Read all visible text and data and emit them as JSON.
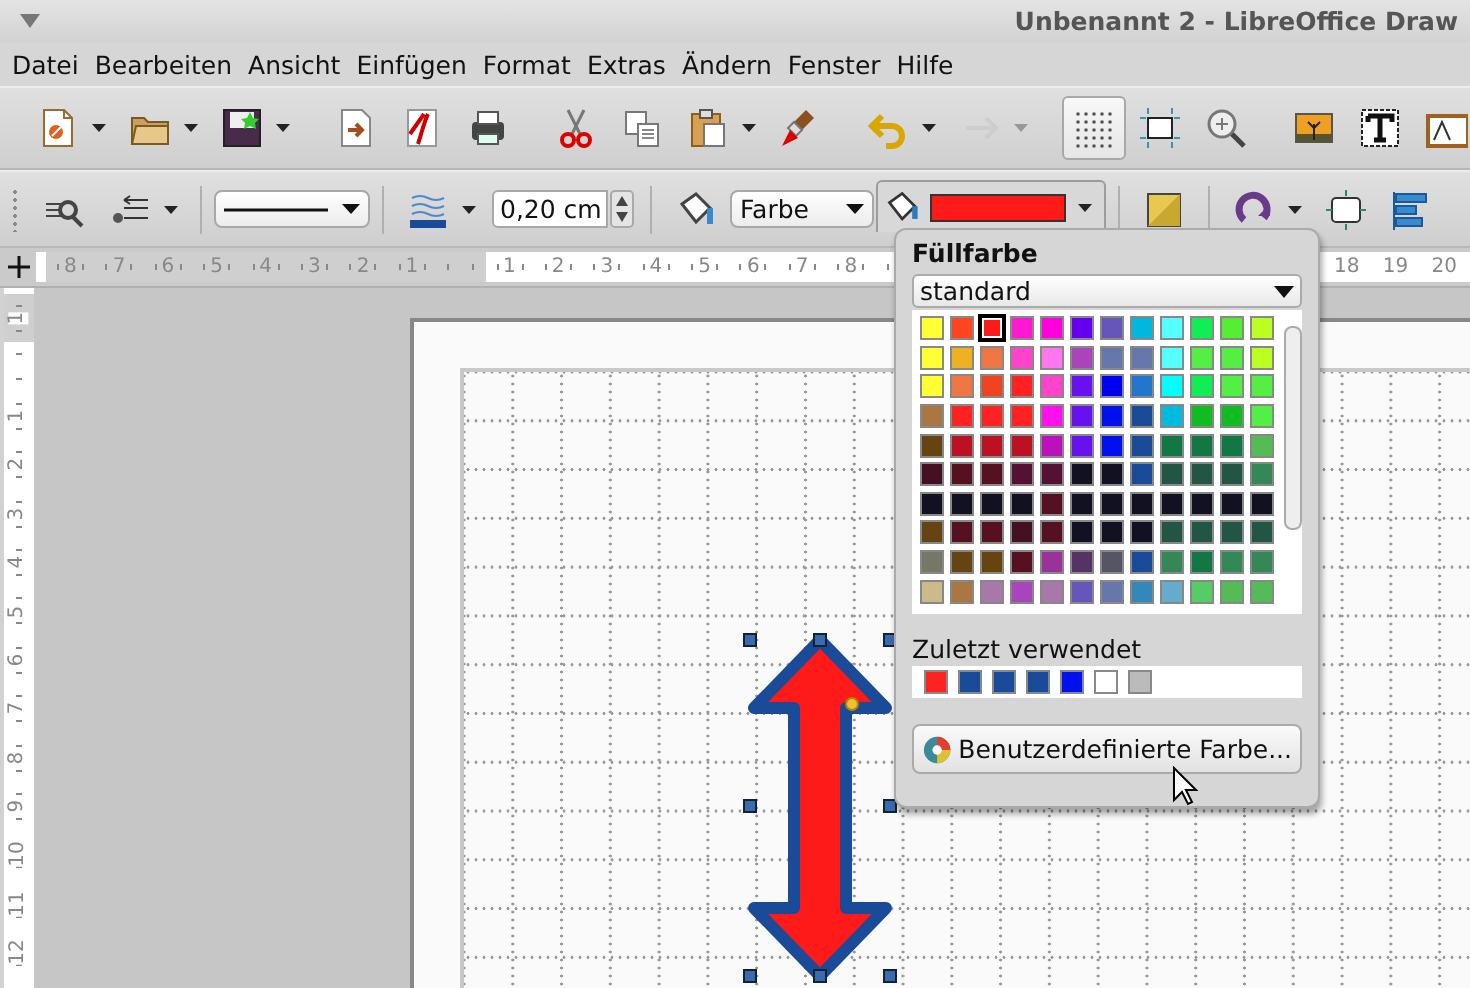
{
  "window": {
    "title": "Unbenannt 2 - LibreOffice Draw"
  },
  "menu": [
    "Datei",
    "Bearbeiten",
    "Ansicht",
    "Einfügen",
    "Format",
    "Extras",
    "Ändern",
    "Fenster",
    "Hilfe"
  ],
  "standard_toolbar": [
    {
      "kind": "button",
      "dropdown": true,
      "disabled": false,
      "pressed": false
    },
    {
      "kind": "button",
      "dropdown": true,
      "disabled": false,
      "pressed": false
    },
    {
      "kind": "button",
      "dropdown": true,
      "disabled": false,
      "pressed": false
    },
    {
      "kind": "separator"
    },
    {
      "kind": "button",
      "dropdown": false,
      "disabled": false,
      "pressed": false
    },
    {
      "kind": "button",
      "dropdown": false,
      "disabled": false,
      "pressed": false
    },
    {
      "kind": "button",
      "dropdown": false,
      "disabled": false,
      "pressed": false
    },
    {
      "kind": "separator"
    },
    {
      "kind": "button",
      "dropdown": false,
      "disabled": false,
      "pressed": false
    },
    {
      "kind": "button",
      "dropdown": false,
      "disabled": false,
      "pressed": false
    },
    {
      "kind": "button",
      "dropdown": true,
      "disabled": false,
      "pressed": false
    },
    {
      "kind": "button",
      "dropdown": false,
      "disabled": false,
      "pressed": false
    },
    {
      "kind": "separator"
    },
    {
      "kind": "button",
      "dropdown": true,
      "disabled": false,
      "pressed": false
    },
    {
      "kind": "button",
      "dropdown": true,
      "disabled": true,
      "pressed": false
    },
    {
      "kind": "separator"
    },
    {
      "kind": "button",
      "dropdown": false,
      "disabled": false,
      "pressed": true
    },
    {
      "kind": "button",
      "dropdown": false,
      "disabled": false,
      "pressed": false
    },
    {
      "kind": "button",
      "dropdown": false,
      "disabled": false,
      "pressed": false
    },
    {
      "kind": "separator"
    },
    {
      "kind": "button",
      "dropdown": false,
      "disabled": false,
      "pressed": false
    },
    {
      "kind": "button",
      "dropdown": false,
      "disabled": false,
      "pressed": false
    },
    {
      "kind": "button",
      "dropdown": false,
      "disabled": false,
      "pressed": false
    }
  ],
  "line_fill_toolbar": [
    {
      "kind": "button",
      "dropdown": false,
      "disabled": false,
      "pressed": false
    },
    {
      "kind": "button",
      "dropdown": true,
      "disabled": false,
      "pressed": false
    },
    {
      "kind": "separator"
    },
    {
      "kind": "linestyle"
    },
    {
      "kind": "separator"
    },
    {
      "kind": "button",
      "dropdown": true,
      "disabled": false,
      "pressed": false
    },
    {
      "kind": "spin",
      "value": "0,20 cm"
    },
    {
      "kind": "separator"
    },
    {
      "kind": "button",
      "dropdown": false,
      "disabled": false,
      "pressed": false
    },
    {
      "kind": "select",
      "value": "Farbe"
    },
    {
      "kind": "color",
      "expanded": true,
      "color": "#ff1a1a"
    },
    {
      "kind": "separator"
    },
    {
      "kind": "button",
      "dropdown": false,
      "disabled": false,
      "pressed": false
    },
    {
      "kind": "separator"
    },
    {
      "kind": "button",
      "dropdown": true,
      "disabled": false,
      "pressed": false
    },
    {
      "kind": "button",
      "dropdown": false,
      "disabled": false,
      "pressed": false
    },
    {
      "kind": "button",
      "dropdown": false,
      "disabled": false,
      "pressed": false
    }
  ],
  "horizontal_ruler": {
    "left_labels": [
      "8",
      "7",
      "6",
      "5",
      "4",
      "3",
      "2",
      "1"
    ],
    "right_labels": [
      "1",
      "2",
      "3",
      "4",
      "5",
      "6",
      "7",
      "8"
    ],
    "far_labels": [
      "18",
      "19",
      "20"
    ]
  },
  "vertical_ruler": {
    "top_labels": [
      "1"
    ],
    "labels": [
      "1",
      "2",
      "3",
      "4",
      "5",
      "6",
      "7",
      "8",
      "9",
      "10",
      "11",
      "12"
    ]
  },
  "canvas": {
    "shape": {
      "selected": true
    }
  },
  "fill_color_popup": {
    "title": "Füllfarbe",
    "palette_select": "standard",
    "palette": [
      {
        "swatches": [
          {
            "color": "#ffff33",
            "selected": false
          },
          {
            "color": "#ff4422",
            "selected": false
          },
          {
            "color": "#ff1a1a",
            "selected": true
          },
          {
            "color": "#ff19d0",
            "selected": false
          },
          {
            "color": "#ff00dd",
            "selected": false
          },
          {
            "color": "#6600ee",
            "selected": false
          },
          {
            "color": "#6655bb",
            "selected": false
          },
          {
            "color": "#00b8dd",
            "selected": false
          },
          {
            "color": "#55ffff",
            "selected": false
          },
          {
            "color": "#11ee55",
            "selected": false
          },
          {
            "color": "#55ee33",
            "selected": false
          },
          {
            "color": "#bbff22",
            "selected": false
          }
        ]
      },
      {
        "swatches": [
          {
            "color": "#ffff33",
            "selected": false
          },
          {
            "color": "#eeb122",
            "selected": false
          },
          {
            "color": "#ee7744",
            "selected": false
          },
          {
            "color": "#ff44cc",
            "selected": false
          },
          {
            "color": "#ff77ee",
            "selected": false
          },
          {
            "color": "#aa44bb",
            "selected": false
          },
          {
            "color": "#6677aa",
            "selected": false
          },
          {
            "color": "#6677ab",
            "selected": false
          },
          {
            "color": "#55ffff",
            "selected": false
          },
          {
            "color": "#55ee44",
            "selected": false
          },
          {
            "color": "#55ee44",
            "selected": false
          },
          {
            "color": "#bbff22",
            "selected": false
          }
        ]
      },
      {
        "swatches": [
          {
            "color": "#ffff33",
            "selected": false
          },
          {
            "color": "#ee7744",
            "selected": false
          },
          {
            "color": "#ee4422",
            "selected": false
          },
          {
            "color": "#ff2222",
            "selected": false
          },
          {
            "color": "#ff44cc",
            "selected": false
          },
          {
            "color": "#6611ee",
            "selected": false
          },
          {
            "color": "#0000ee",
            "selected": false
          },
          {
            "color": "#2277cc",
            "selected": false
          },
          {
            "color": "#00ffff",
            "selected": false
          },
          {
            "color": "#11ee55",
            "selected": false
          },
          {
            "color": "#55ee44",
            "selected": false
          },
          {
            "color": "#55ee44",
            "selected": false
          }
        ]
      },
      {
        "swatches": [
          {
            "color": "#aa7744",
            "selected": false
          },
          {
            "color": "#ff2222",
            "selected": false
          },
          {
            "color": "#ff2222",
            "selected": false
          },
          {
            "color": "#ff2222",
            "selected": false
          },
          {
            "color": "#ff11ee",
            "selected": false
          },
          {
            "color": "#6611ee",
            "selected": false
          },
          {
            "color": "#0011ee",
            "selected": false
          },
          {
            "color": "#1a4b99",
            "selected": false
          },
          {
            "color": "#00bbdd",
            "selected": false
          },
          {
            "color": "#11bb22",
            "selected": false
          },
          {
            "color": "#11bb22",
            "selected": false
          },
          {
            "color": "#55ee44",
            "selected": false
          }
        ]
      },
      {
        "swatches": [
          {
            "color": "#664411",
            "selected": false
          },
          {
            "color": "#bb1122",
            "selected": false
          },
          {
            "color": "#bb1122",
            "selected": false
          },
          {
            "color": "#bb1122",
            "selected": false
          },
          {
            "color": "#bb11bb",
            "selected": false
          },
          {
            "color": "#6611ee",
            "selected": false
          },
          {
            "color": "#0011ee",
            "selected": false
          },
          {
            "color": "#1a4b99",
            "selected": false
          },
          {
            "color": "#117744",
            "selected": false
          },
          {
            "color": "#117744",
            "selected": false
          },
          {
            "color": "#117744",
            "selected": false
          },
          {
            "color": "#55bb55",
            "selected": false
          }
        ]
      },
      {
        "swatches": [
          {
            "color": "#441122",
            "selected": false
          },
          {
            "color": "#551122",
            "selected": false
          },
          {
            "color": "#551122",
            "selected": false
          },
          {
            "color": "#551133",
            "selected": false
          },
          {
            "color": "#551133",
            "selected": false
          },
          {
            "color": "#111122",
            "selected": false
          },
          {
            "color": "#111122",
            "selected": false
          },
          {
            "color": "#1a4b99",
            "selected": false
          },
          {
            "color": "#225544",
            "selected": false
          },
          {
            "color": "#225544",
            "selected": false
          },
          {
            "color": "#225544",
            "selected": false
          },
          {
            "color": "#338855",
            "selected": false
          }
        ]
      },
      {
        "swatches": [
          {
            "color": "#111122",
            "selected": false
          },
          {
            "color": "#111122",
            "selected": false
          },
          {
            "color": "#111122",
            "selected": false
          },
          {
            "color": "#111122",
            "selected": false
          },
          {
            "color": "#551122",
            "selected": false
          },
          {
            "color": "#111122",
            "selected": false
          },
          {
            "color": "#111122",
            "selected": false
          },
          {
            "color": "#111122",
            "selected": false
          },
          {
            "color": "#111122",
            "selected": false
          },
          {
            "color": "#111122",
            "selected": false
          },
          {
            "color": "#111122",
            "selected": false
          },
          {
            "color": "#111122",
            "selected": false
          }
        ]
      },
      {
        "swatches": [
          {
            "color": "#664411",
            "selected": false
          },
          {
            "color": "#551122",
            "selected": false
          },
          {
            "color": "#551122",
            "selected": false
          },
          {
            "color": "#441122",
            "selected": false
          },
          {
            "color": "#551122",
            "selected": false
          },
          {
            "color": "#111122",
            "selected": false
          },
          {
            "color": "#111122",
            "selected": false
          },
          {
            "color": "#111122",
            "selected": false
          },
          {
            "color": "#225544",
            "selected": false
          },
          {
            "color": "#225544",
            "selected": false
          },
          {
            "color": "#225544",
            "selected": false
          },
          {
            "color": "#225544",
            "selected": false
          }
        ]
      },
      {
        "swatches": [
          {
            "color": "#777766",
            "selected": false
          },
          {
            "color": "#664411",
            "selected": false
          },
          {
            "color": "#664411",
            "selected": false
          },
          {
            "color": "#551122",
            "selected": false
          },
          {
            "color": "#993399",
            "selected": false
          },
          {
            "color": "#553366",
            "selected": false
          },
          {
            "color": "#555566",
            "selected": false
          },
          {
            "color": "#1a4b99",
            "selected": false
          },
          {
            "color": "#338855",
            "selected": false
          },
          {
            "color": "#117744",
            "selected": false
          },
          {
            "color": "#338855",
            "selected": false
          },
          {
            "color": "#338855",
            "selected": false
          }
        ]
      },
      {
        "swatches": [
          {
            "color": "#ccbb88",
            "selected": false
          },
          {
            "color": "#aa7744",
            "selected": false
          },
          {
            "color": "#aa77aa",
            "selected": false
          },
          {
            "color": "#aa44bb",
            "selected": false
          },
          {
            "color": "#aa77ab",
            "selected": false
          },
          {
            "color": "#6655bb",
            "selected": false
          },
          {
            "color": "#6677aa",
            "selected": false
          },
          {
            "color": "#3388bb",
            "selected": false
          },
          {
            "color": "#66aacc",
            "selected": false
          },
          {
            "color": "#55cc66",
            "selected": false
          },
          {
            "color": "#55bb55",
            "selected": false
          },
          {
            "color": "#55bb56",
            "selected": false
          }
        ]
      }
    ],
    "recent_label": "Zuletzt verwendet",
    "recent": [
      {
        "color": "#ff2222"
      },
      {
        "color": "#1a4b99"
      },
      {
        "color": "#1a4b9a"
      },
      {
        "color": "#1a4b9b"
      },
      {
        "color": "#0011ee"
      },
      {
        "color": "#ffffff"
      },
      {
        "color": "#bbbbbb"
      }
    ],
    "custom_button": "Benutzerdefinierte Farbe..."
  }
}
